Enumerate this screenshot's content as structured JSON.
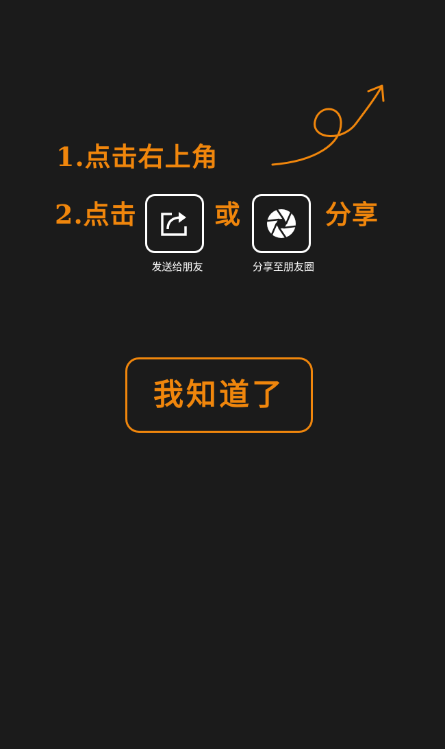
{
  "guide": {
    "step1": "1.点击右上角",
    "step2_prefix": "2.点击",
    "step2_or": "或",
    "step2_suffix": "分享"
  },
  "share_options": [
    {
      "label": "发送给朋友",
      "icon": "share-forward-icon"
    },
    {
      "label": "分享至朋友圈",
      "icon": "moments-aperture-icon"
    }
  ],
  "dismiss_button": {
    "label": "我知道了"
  },
  "colors": {
    "background": "#1b1b1b",
    "accent": "#f0860c",
    "icon_stroke": "#ffffff"
  },
  "decorations": {
    "arrow": "curly-arrow-up-right-icon"
  }
}
